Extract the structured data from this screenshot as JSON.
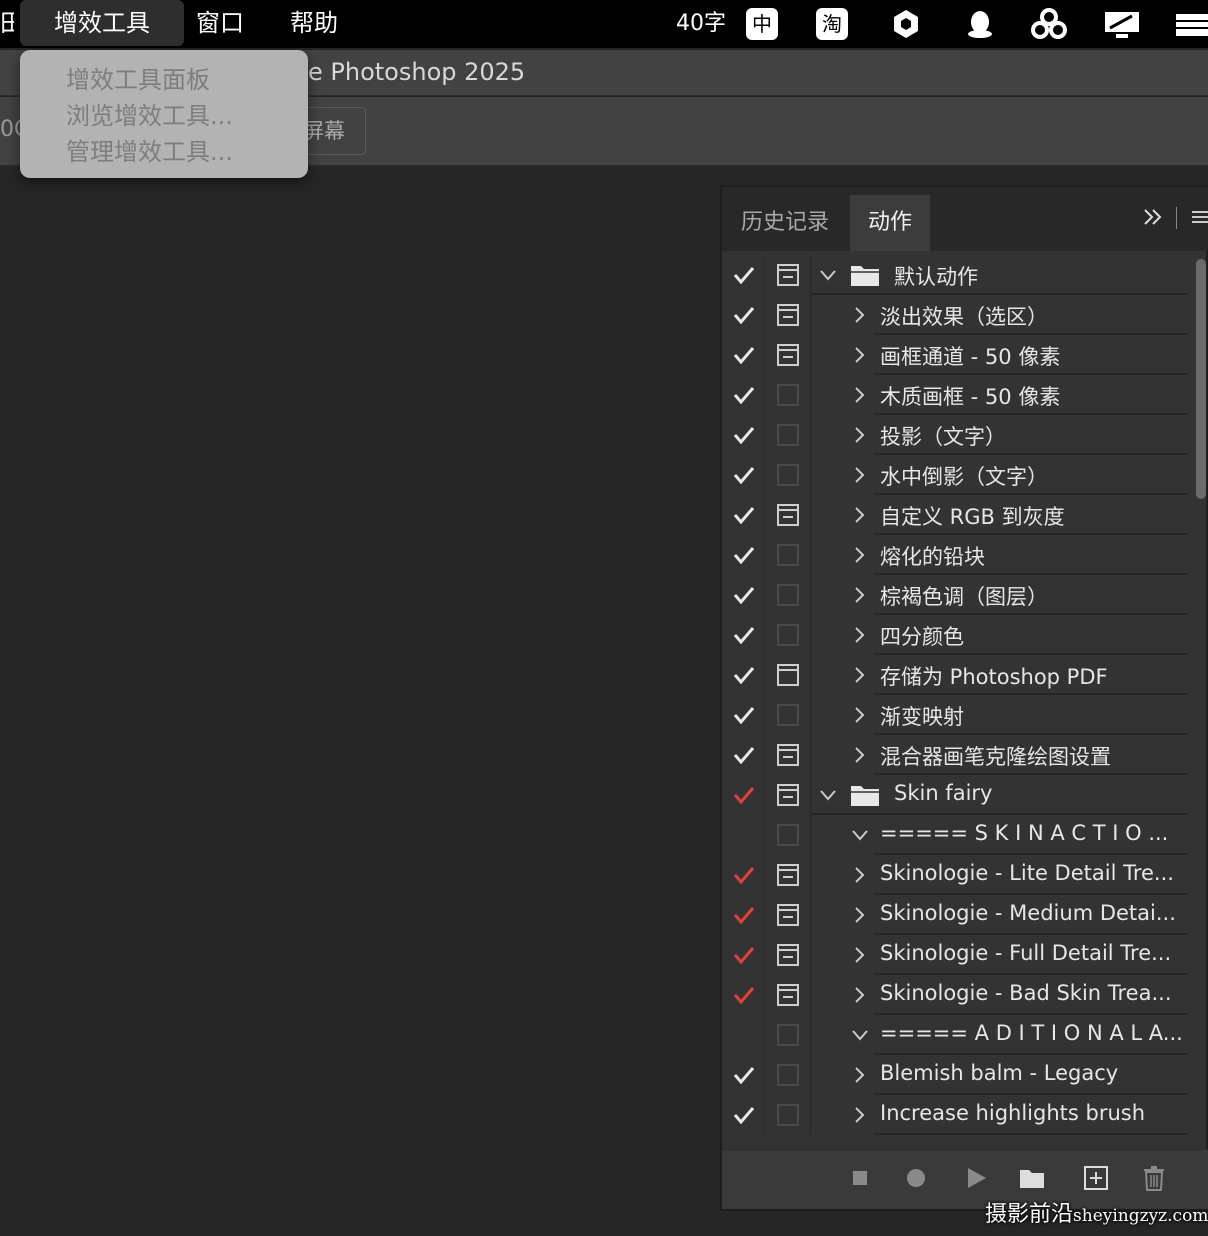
{
  "menubar": {
    "left_fragment": "田",
    "items": [
      "增效工具",
      "窗口",
      "帮助"
    ],
    "word_count": "40字",
    "ime_label": "中",
    "taobao_label": "淘"
  },
  "titlebar": {
    "title": "e Photoshop 2025"
  },
  "optionsbar": {
    "left_text": "0C",
    "button_label": "屏幕"
  },
  "dropdown": {
    "items": [
      "增效工具面板",
      "浏览增效工具...",
      "管理增效工具..."
    ]
  },
  "panel": {
    "tabs": {
      "history": "历史记录",
      "actions": "动作"
    },
    "rows": [
      {
        "level": 0,
        "label": "默认动作",
        "check": "white",
        "dialog": "filled",
        "expanded": true,
        "folder": true
      },
      {
        "level": 1,
        "label": "淡出效果（选区）",
        "check": "white",
        "dialog": "filled"
      },
      {
        "level": 1,
        "label": "画框通道 - 50 像素",
        "check": "white",
        "dialog": "filled"
      },
      {
        "level": 1,
        "label": "木质画框 - 50 像素",
        "check": "white",
        "dialog": "empty"
      },
      {
        "level": 1,
        "label": "投影（文字）",
        "check": "white",
        "dialog": "empty"
      },
      {
        "level": 1,
        "label": "水中倒影（文字）",
        "check": "white",
        "dialog": "empty"
      },
      {
        "level": 1,
        "label": "自定义 RGB 到灰度",
        "check": "white",
        "dialog": "filled"
      },
      {
        "level": 1,
        "label": "熔化的铅块",
        "check": "white",
        "dialog": "empty"
      },
      {
        "level": 1,
        "label": "棕褐色调（图层）",
        "check": "white",
        "dialog": "empty"
      },
      {
        "level": 1,
        "label": "四分颜色",
        "check": "white",
        "dialog": "empty"
      },
      {
        "level": 1,
        "label": "存储为 Photoshop PDF",
        "check": "white",
        "dialog": "outline"
      },
      {
        "level": 1,
        "label": "渐变映射",
        "check": "white",
        "dialog": "empty"
      },
      {
        "level": 1,
        "label": "混合器画笔克隆绘图设置",
        "check": "white",
        "dialog": "filled"
      },
      {
        "level": 0,
        "label": "Skin fairy",
        "check": "red",
        "dialog": "filled",
        "expanded": true,
        "folder": true
      },
      {
        "level": 1,
        "label": "===== S K I N   A C T I O ...",
        "check": "none",
        "dialog": "empty",
        "expanded": true
      },
      {
        "level": 1,
        "label": "Skinologie - Lite Detail Tre...",
        "check": "red",
        "dialog": "filled"
      },
      {
        "level": 1,
        "label": "Skinologie - Medium Detai...",
        "check": "red",
        "dialog": "filled"
      },
      {
        "level": 1,
        "label": "Skinologie - Full Detail Tre...",
        "check": "red",
        "dialog": "filled"
      },
      {
        "level": 1,
        "label": "Skinologie - Bad Skin Trea...",
        "check": "red",
        "dialog": "filled"
      },
      {
        "level": 1,
        "label": "===== A D I T I O N A L   A...",
        "check": "none",
        "dialog": "empty",
        "expanded": true
      },
      {
        "level": 1,
        "label": "Blemish balm - Legacy",
        "check": "white",
        "dialog": "empty"
      },
      {
        "level": 1,
        "label": "Increase highlights brush",
        "check": "white",
        "dialog": "empty"
      }
    ]
  },
  "colors": {
    "red_check": "#e0403a",
    "white_check": "#e8e8e8"
  },
  "watermark": {
    "main": "摄影前沿",
    "url": "sheyingzyz.com"
  }
}
